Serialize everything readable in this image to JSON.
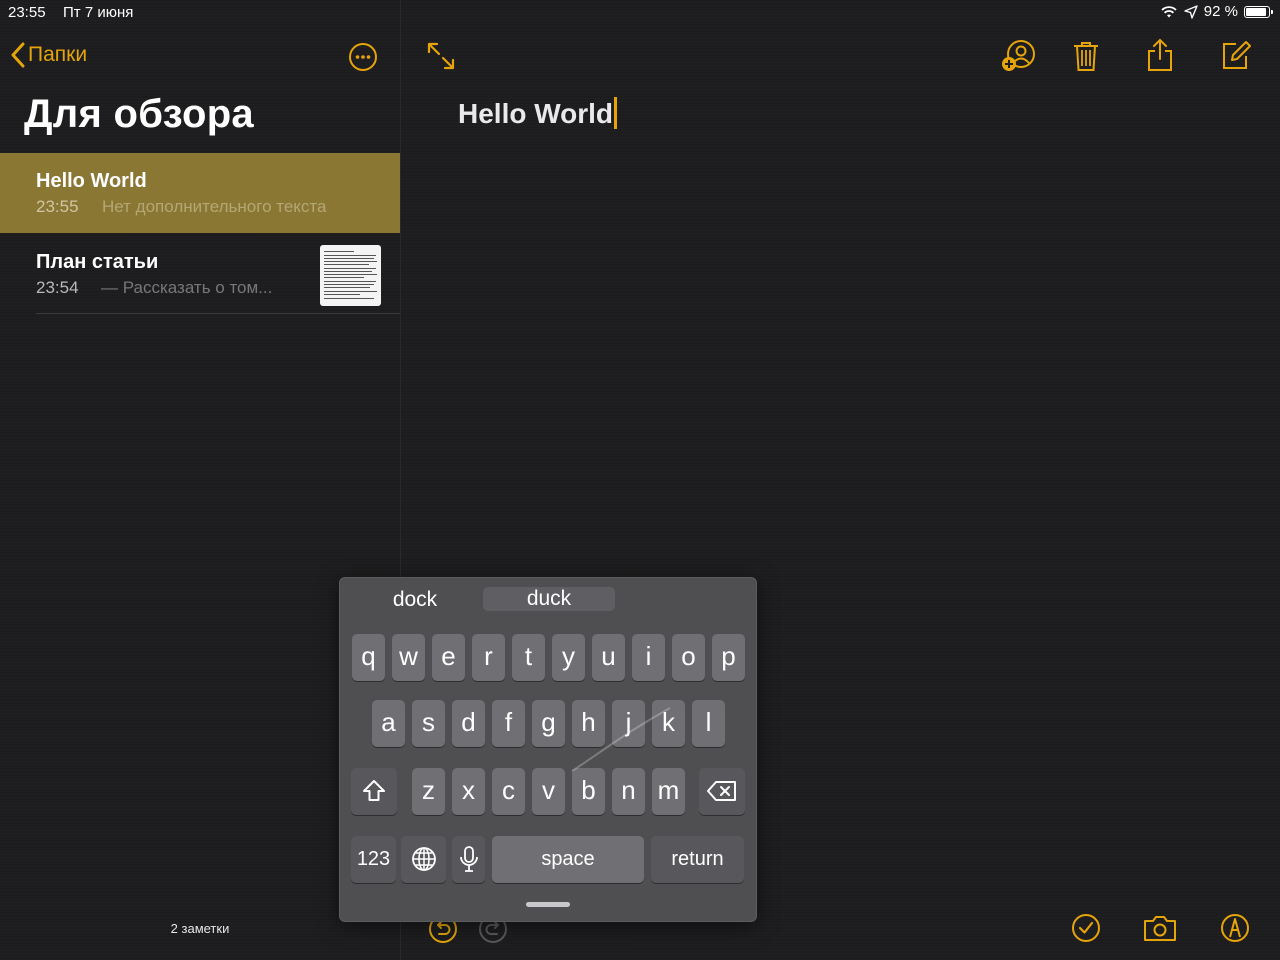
{
  "status_bar": {
    "time": "23:55",
    "date": "Пт 7 июня",
    "battery_text": "92 %",
    "battery_level": 0.92,
    "icons": [
      "wifi-icon",
      "location-icon",
      "battery-icon"
    ]
  },
  "sidebar": {
    "back_label": "Папки",
    "folder_title": "Для обзора",
    "notes": [
      {
        "title": "Hello World",
        "time": "23:55",
        "preview": "Нет дополнительного текста",
        "selected": true
      },
      {
        "title": "План статьи",
        "time": "23:54",
        "preview": "— Рассказать о том...",
        "selected": false,
        "has_thumbnail": true
      }
    ],
    "notes_count": "2 заметки"
  },
  "editor": {
    "heading": "Hello World",
    "toolbar_icons": [
      "expand-icon",
      "add-people-icon",
      "trash-icon",
      "share-icon",
      "compose-icon"
    ],
    "bottom_icons": [
      "undo-icon",
      "redo-icon",
      "checklist-icon",
      "camera-icon",
      "markup-icon"
    ]
  },
  "keyboard": {
    "suggestions": [
      "dock",
      "duck",
      ""
    ],
    "row1": [
      "q",
      "w",
      "e",
      "r",
      "t",
      "y",
      "u",
      "i",
      "o",
      "p"
    ],
    "row2": [
      "a",
      "s",
      "d",
      "f",
      "g",
      "h",
      "j",
      "k",
      "l"
    ],
    "row3": [
      "z",
      "x",
      "c",
      "v",
      "b",
      "n",
      "m"
    ],
    "numbers_label": "123",
    "space_label": "space",
    "return_label": "return"
  },
  "colors": {
    "accent": "#e5a50a",
    "selected_row": "#8b7734",
    "background": "#1d1d1f",
    "key": "#707074"
  }
}
